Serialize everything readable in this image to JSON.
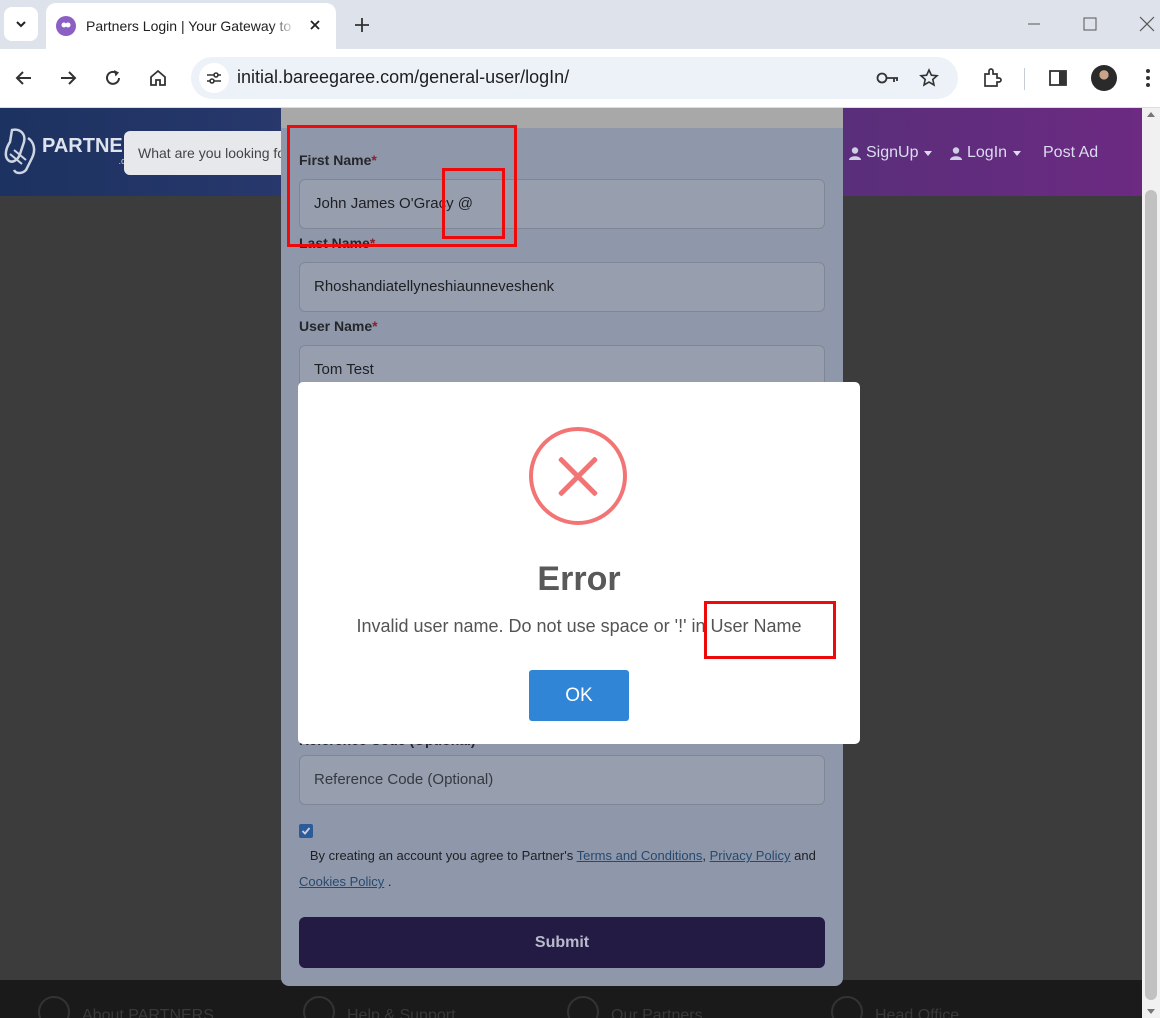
{
  "browser": {
    "tab_title": "Partners Login | Your Gateway to",
    "url": "initial.bareegaree.com/general-user/logIn/"
  },
  "site": {
    "logo_text": "PARTNERS",
    "logo_sub": ".com.bd",
    "search_placeholder": "What are you looking for",
    "nav": {
      "signup": "SignUp",
      "login": "LogIn",
      "post_ad": "Post Ad"
    },
    "footer": [
      "About PARTNERS",
      "Help & Support",
      "Our Partners",
      "Head Office"
    ]
  },
  "form": {
    "first_name_label": "First Name",
    "first_name_value": "John James O'Gracy @",
    "last_name_label": "Last Name",
    "last_name_value": "Rhoshandiatellyneshiaunneveshenk",
    "user_name_label": "User Name",
    "user_name_value": "Tom Test",
    "required_mark": "*",
    "reference_label": "Reference Code (Optional)",
    "reference_placeholder": "Reference Code (Optional)",
    "agree_prefix": "By creating an account you agree to Partner's",
    "terms_link": "Terms and Conditions",
    "comma": ",",
    "privacy_link": "Privacy Policy",
    "and_text": "and",
    "cookies_link": "Cookies Policy",
    "period": ".",
    "submit_label": "Submit",
    "agree_checked": true
  },
  "dialog": {
    "title": "Error",
    "message": "Invalid user name. Do not use space or '!' in User Name",
    "ok_label": "OK",
    "icon": "error-x-icon"
  },
  "colors": {
    "annotation": "#ee0a0a",
    "ok_button": "#3085d6",
    "error_icon": "#f27474"
  }
}
